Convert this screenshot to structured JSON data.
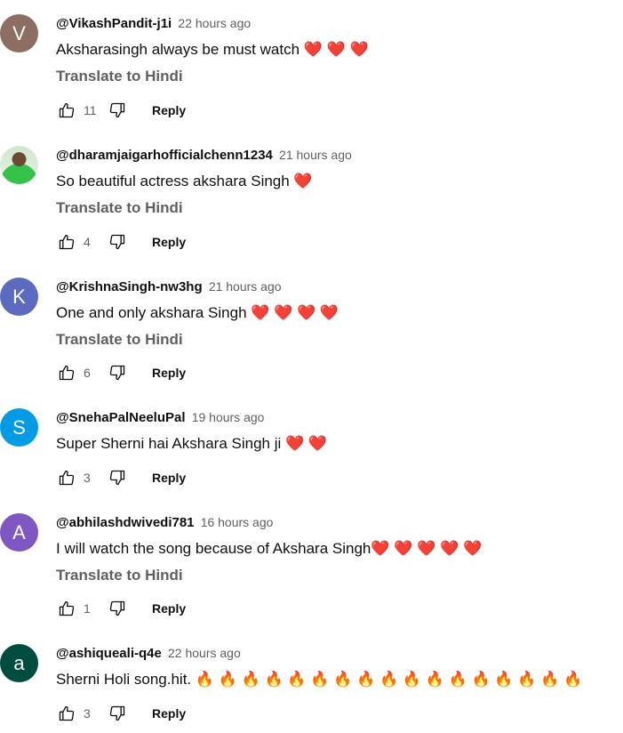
{
  "comments": [
    {
      "author": "@VikashPandit-j1i",
      "time": "22 hours ago",
      "text": "Aksharasingh always be must watch ❤️ ❤️ ❤️",
      "translate": "Translate to Hindi",
      "likes": "11",
      "reply": "Reply",
      "avatar_letter": "V",
      "avatar_color": "#8d6e63"
    },
    {
      "author": "@dharamjaigarhofficialchenn1234",
      "time": "21 hours ago",
      "text": "So beautiful actress akshara Singh ❤️",
      "translate": "Translate to Hindi",
      "likes": "4",
      "reply": "Reply",
      "avatar_letter": "",
      "avatar_color": "#cfe6cf"
    },
    {
      "author": "@KrishnaSingh-nw3hg",
      "time": "21 hours ago",
      "text": "One and only akshara Singh ❤️ ❤️ ❤️ ❤️",
      "translate": "Translate to Hindi",
      "likes": "6",
      "reply": "Reply",
      "avatar_letter": "K",
      "avatar_color": "#5c6bc0"
    },
    {
      "author": "@SnehaPalNeeluPal",
      "time": "19 hours ago",
      "text": "Super Sherni hai Akshara Singh ji ❤️ ❤️",
      "translate": "",
      "likes": "3",
      "reply": "Reply",
      "avatar_letter": "S",
      "avatar_color": "#039be5"
    },
    {
      "author": "@abhilashdwivedi781",
      "time": "16 hours ago",
      "text": "I will watch the song because of Akshara Singh❤️ ❤️ ❤️ ❤️ ❤️",
      "translate": "Translate to Hindi",
      "likes": "1",
      "reply": "Reply",
      "avatar_letter": "A",
      "avatar_color": "#7e57c2"
    },
    {
      "author": "@ashiqueali-q4e",
      "time": "22 hours ago",
      "text": "Sherni Holi song.hit. 🔥 🔥 🔥 🔥 🔥 🔥 🔥 🔥 🔥 🔥 🔥 🔥 🔥 🔥 🔥 🔥 🔥",
      "translate": "",
      "likes": "3",
      "reply": "Reply",
      "avatar_letter": "a",
      "avatar_color": "#004d40"
    }
  ]
}
